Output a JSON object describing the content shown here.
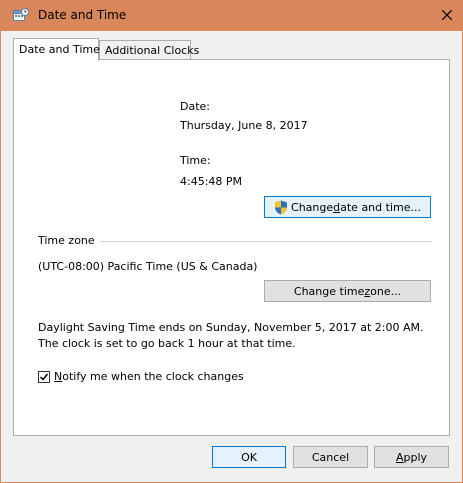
{
  "window": {
    "title": "Date and Time"
  },
  "tabs": [
    {
      "label": "Date and Time",
      "active": true
    },
    {
      "label": "Additional Clocks",
      "active": false
    }
  ],
  "date_section": {
    "label": "Date:",
    "value": "Thursday, June 8, 2017"
  },
  "time_section": {
    "label": "Time:",
    "value": "4:45:48 PM"
  },
  "change_date_button": {
    "label_pre": "Change ",
    "label_key": "d",
    "label_post": "ate and time..."
  },
  "timezone": {
    "group_label": "Time zone",
    "value": "(UTC-08:00) Pacific Time (US & Canada)",
    "change_button": {
      "label_pre": "Change time ",
      "label_key": "z",
      "label_post": "one..."
    }
  },
  "dst_text": "Daylight Saving Time ends on Sunday, November 5, 2017 at 2:00 AM. The clock is set to go back 1 hour at that time.",
  "notify": {
    "label_key": "N",
    "label_rest": "otify me when the clock changes",
    "checked": true
  },
  "footer": {
    "ok": "OK",
    "cancel": "Cancel",
    "apply_key": "A",
    "apply_rest": "pply"
  },
  "icons": {
    "app": "calendar-clock-icon",
    "close": "close-icon",
    "shield": "uac-shield-icon",
    "check": "checkmark-icon"
  },
  "colors": {
    "titlebar": "#d9875a",
    "client": "#f0f0f0",
    "panel": "#ffffff",
    "default_button_border": "#0078d7"
  }
}
